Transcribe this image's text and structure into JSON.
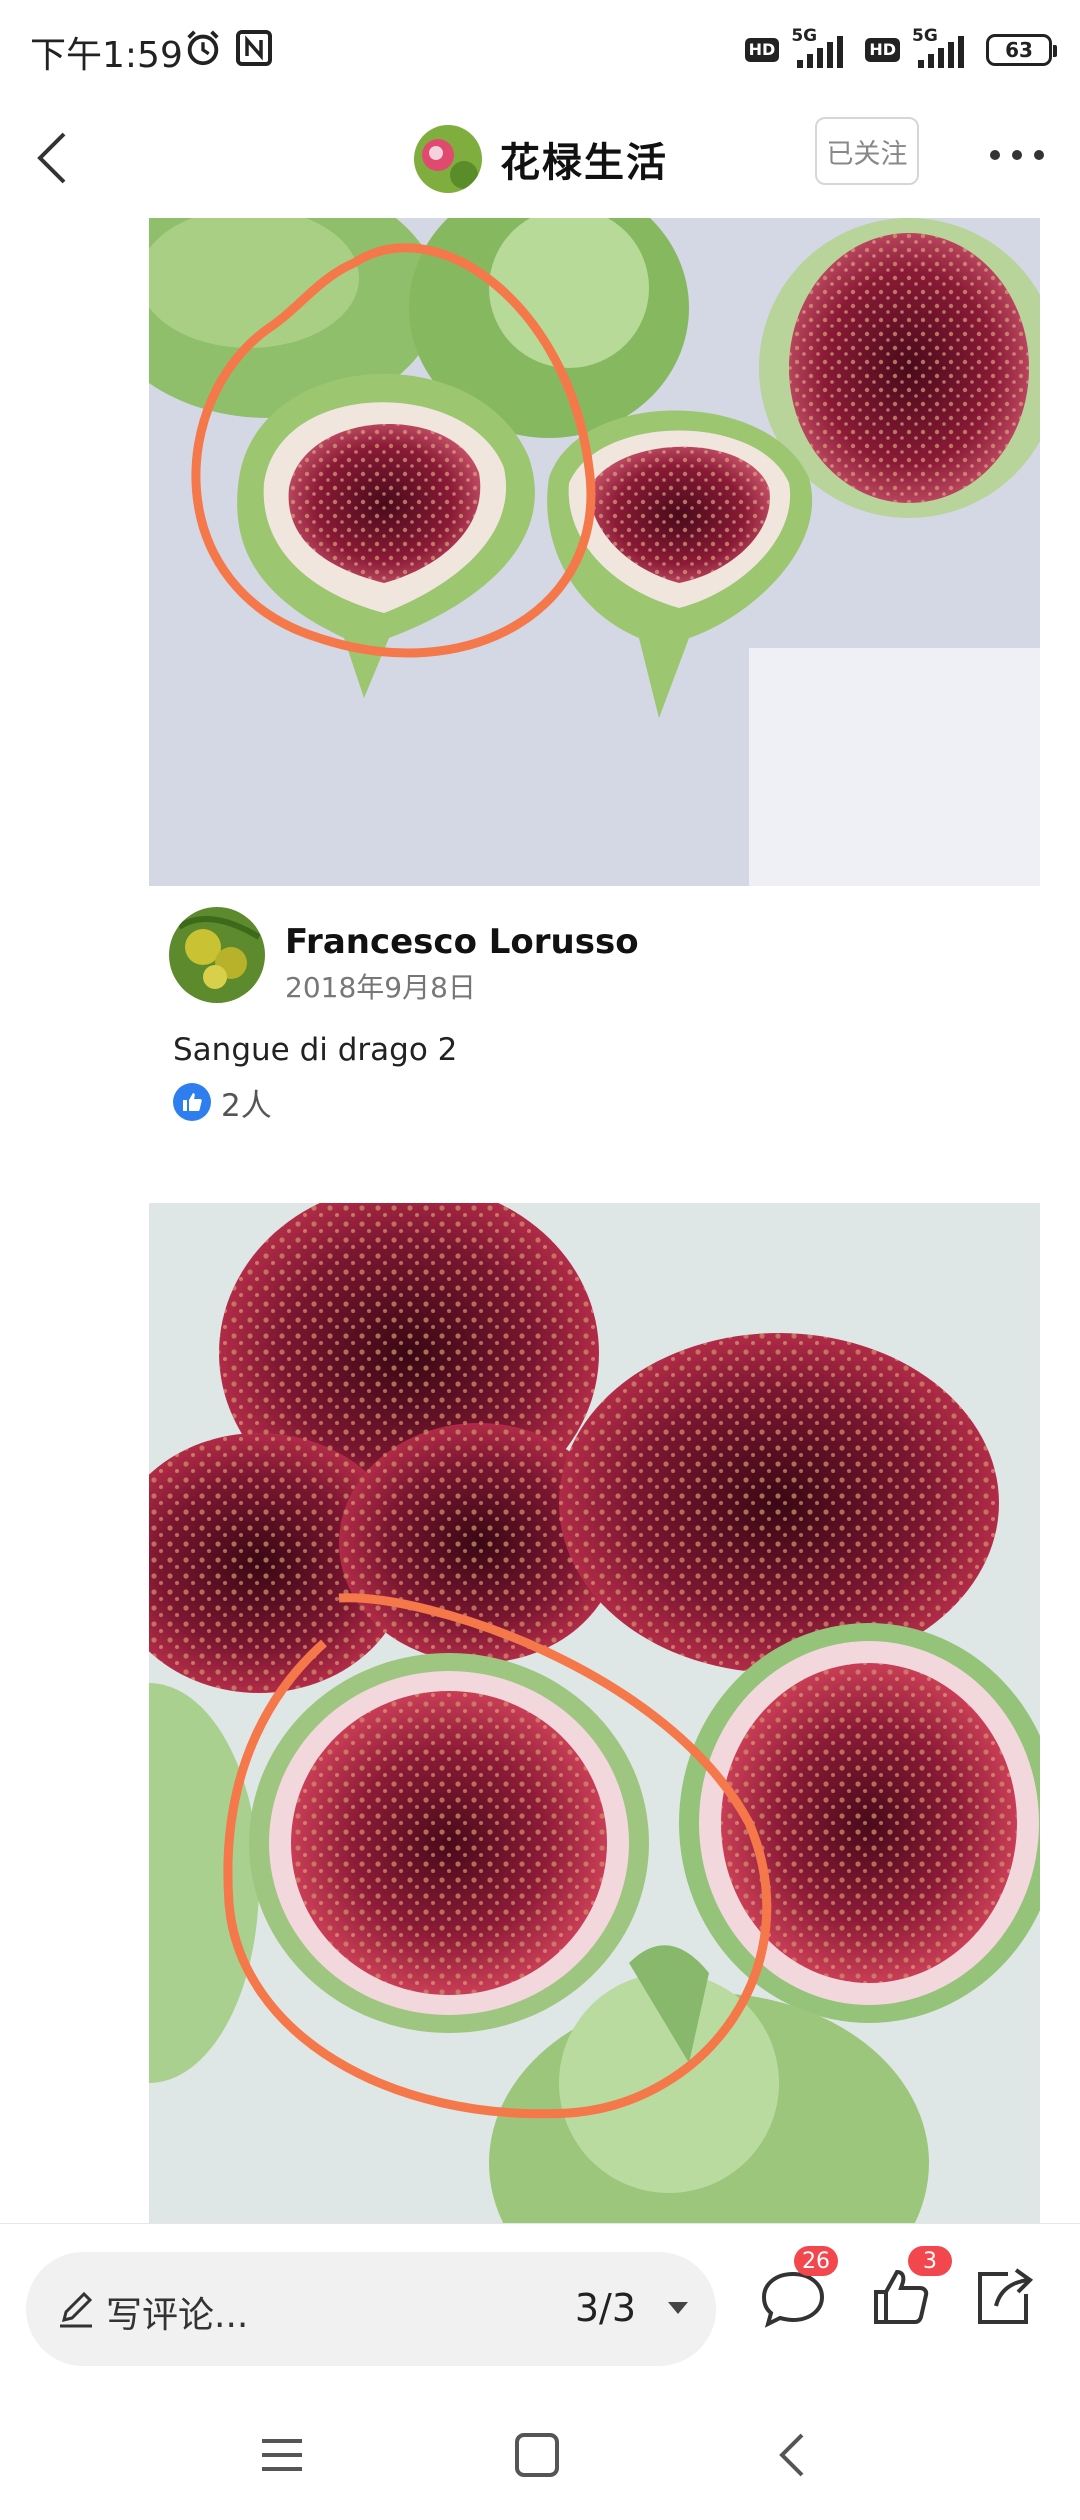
{
  "status_bar": {
    "time": "下午1:59",
    "hd_label": "HD",
    "network_label": "5G",
    "battery": "63"
  },
  "header": {
    "account_name": "花椂生活",
    "follow_label": "已关注"
  },
  "post": {
    "author": "Francesco Lorusso",
    "date": "2018年9月8日",
    "caption": "Sangue di drago 2",
    "likes": "2人"
  },
  "toolbar": {
    "comment_placeholder": "写评论...",
    "page_indicator": "3/3",
    "comment_count": "26",
    "like_count": "3"
  },
  "colors": {
    "annotation_circle": "#f4784a",
    "fig_flesh": "#7b1630",
    "fig_skin": "#8fbf6a",
    "badge": "#f3474e",
    "like_blue": "#2f7ef0"
  }
}
